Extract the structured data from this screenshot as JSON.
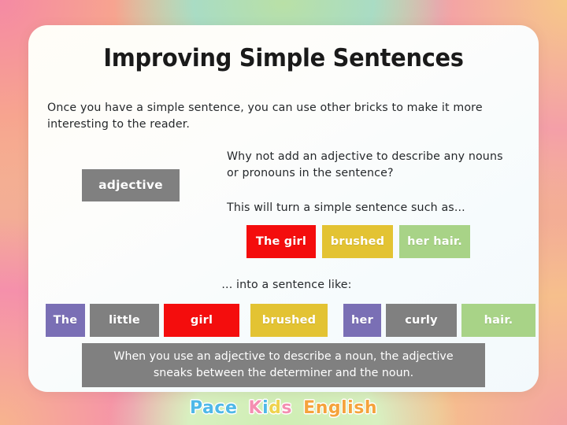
{
  "slide": {
    "title": "Improving Simple Sentences",
    "intro": "Once you have a simple sentence, you can use other bricks to make it more interesting to the reader.",
    "adjective_question": "Why not add an adjective to describe any nouns or pronouns in the sentence?",
    "turn_sentence_text": "This will turn a simple sentence such as...",
    "into_sentence_text": "... into a sentence like:",
    "summary_note": "When you use an adjective to describe a noun, the adjective sneaks between the determiner and the noun."
  },
  "label_brick": {
    "text": "adjective",
    "color": "#808080"
  },
  "simple_sentence_bricks": [
    {
      "text": "The girl",
      "color": "#f40d0d"
    },
    {
      "text": "brushed",
      "color": "#e3c333"
    },
    {
      "text": "her hair.",
      "color": "#a8d387"
    }
  ],
  "improved_sentence_bricks": [
    {
      "text": "The",
      "color": "#7a6fb5"
    },
    {
      "text": "little",
      "color": "#808080"
    },
    {
      "text": "girl",
      "color": "#f40d0d"
    },
    {
      "text": "brushed",
      "color": "#e3c333"
    },
    {
      "text": "her",
      "color": "#7a6fb5"
    },
    {
      "text": "curly",
      "color": "#808080"
    },
    {
      "text": "hair.",
      "color": "#a8d387"
    }
  ],
  "summary_box": {
    "color": "#808080"
  },
  "footer_logo": {
    "words": [
      {
        "letters": [
          {
            "char": "P",
            "color": "#4fb8e8"
          },
          {
            "char": "a",
            "color": "#4fb8e8"
          },
          {
            "char": "c",
            "color": "#4fb8e8"
          },
          {
            "char": "e",
            "color": "#4fb8e8"
          }
        ]
      },
      {
        "letters": [
          {
            "char": "K",
            "color": "#f48fb1"
          },
          {
            "char": "i",
            "color": "#4fb8e8"
          },
          {
            "char": "d",
            "color": "#efd34e"
          },
          {
            "char": "s",
            "color": "#f48fb1"
          }
        ]
      },
      {
        "letters": [
          {
            "char": "E",
            "color": "#f5a33c"
          },
          {
            "char": "n",
            "color": "#f5a33c"
          },
          {
            "char": "g",
            "color": "#f5a33c"
          },
          {
            "char": "l",
            "color": "#f5a33c"
          },
          {
            "char": "i",
            "color": "#f5a33c"
          },
          {
            "char": "s",
            "color": "#f5a33c"
          },
          {
            "char": "h",
            "color": "#f5a33c"
          }
        ]
      }
    ]
  }
}
